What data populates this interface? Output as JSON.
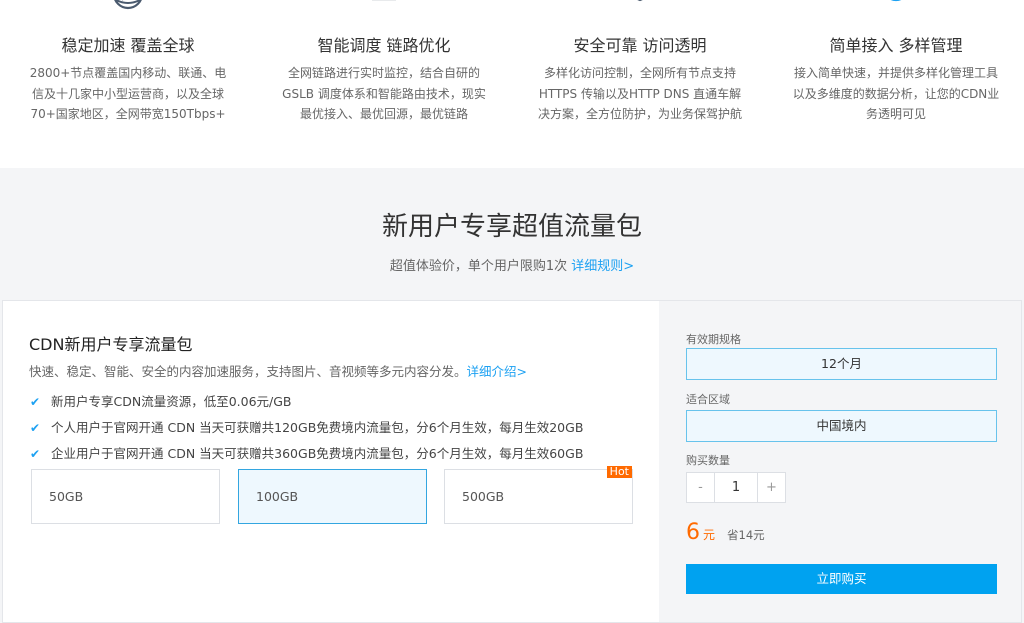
{
  "features": [
    {
      "title": "稳定加速 覆盖全球",
      "desc": "2800+节点覆盖国内移动、联通、电信及十几家中小型运营商，以及全球70+国家地区，全网带宽150Tbps+",
      "icon": "globe-icon"
    },
    {
      "title": "智能调度 链路优化",
      "desc": "全网链路进行实时监控，结合自研的GSLB 调度体系和智能路由技术，现实最优接入、最优回源，最优链路",
      "icon": "monitor-icon"
    },
    {
      "title": "安全可靠 访问透明",
      "desc": "多样化访问控制，全网所有节点支持HTTPS 传输以及HTTP DNS 直通车解决方案，全方位防护，为业务保驾护航",
      "icon": "shield-icon"
    },
    {
      "title": "简单接入 多样管理",
      "desc": "接入简单快速，并提供多样化管理工具以及多维度的数据分析，让您的CDN业务透明可见",
      "icon": "network-icon"
    }
  ],
  "promo": {
    "title": "新用户专享超值流量包",
    "subtitle": "超值体验价，单个用户限购1次",
    "rules_link": "详细规则>"
  },
  "card": {
    "title": "CDN新用户专享流量包",
    "desc": "快速、稳定、智能、安全的内容加速服务，支持图片、音视频等多元内容分发。",
    "detail_link": "详细介绍>",
    "checks": [
      "新用户专享CDN流量资源，低至0.06元/GB",
      "个人用户于官网开通 CDN 当天可获赠共120GB免费境内流量包，分6个月生效，每月生效20GB",
      "企业用户于官网开通 CDN 当天可获赠共360GB免费境内流量包，分6个月生效，每月生效60GB"
    ],
    "options": [
      {
        "label": "50GB"
      },
      {
        "label": "100GB",
        "selected": true
      },
      {
        "label": "500GB",
        "badge": "Hot"
      }
    ]
  },
  "order": {
    "period_label": "有效期规格",
    "period_value": "12个月",
    "region_label": "适合区域",
    "region_value": "中国境内",
    "qty_label": "购买数量",
    "qty_minus": "-",
    "qty_value": "1",
    "qty_plus": "+",
    "price": "6",
    "price_unit": "元",
    "save_text": "省14元",
    "buy_label": "立即购买"
  },
  "colors": {
    "accent": "#1da1f2",
    "price": "#ff6a00",
    "buy_button": "#00a2f0"
  }
}
